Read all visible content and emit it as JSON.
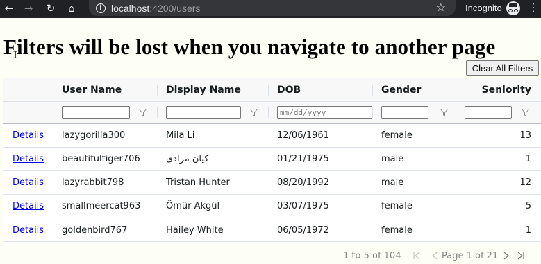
{
  "browser": {
    "host": "localhost",
    "path": ":4200/users",
    "incognito_label": "Incognito"
  },
  "page": {
    "title": "Filters will be lost when you navigate to another page",
    "clear_button": "Clear All Filters"
  },
  "grid": {
    "columns": [
      "",
      "User Name",
      "Display Name",
      "DOB",
      "Gender",
      "Seniority"
    ],
    "dob_filter_placeholder": "mm/dd/yyyy",
    "details_label": "Details",
    "rows": [
      {
        "user": "lazygorilla300",
        "display": "Mila Li",
        "dob": "12/06/1961",
        "gender": "female",
        "seniority": "13"
      },
      {
        "user": "beautifultiger706",
        "display": "کیان مرادی",
        "dob": "01/21/1975",
        "gender": "male",
        "seniority": "1"
      },
      {
        "user": "lazyrabbit798",
        "display": "Tristan Hunter",
        "dob": "08/20/1992",
        "gender": "male",
        "seniority": "12"
      },
      {
        "user": "smallmeercat963",
        "display": "Ömür Akgül",
        "dob": "03/07/1975",
        "gender": "female",
        "seniority": "5"
      },
      {
        "user": "goldenbird767",
        "display": "Hailey White",
        "dob": "06/05/1972",
        "gender": "female",
        "seniority": "1"
      }
    ]
  },
  "paging": {
    "summary": "1 to 5 of 104",
    "page_text": "Page 1 of 21"
  }
}
